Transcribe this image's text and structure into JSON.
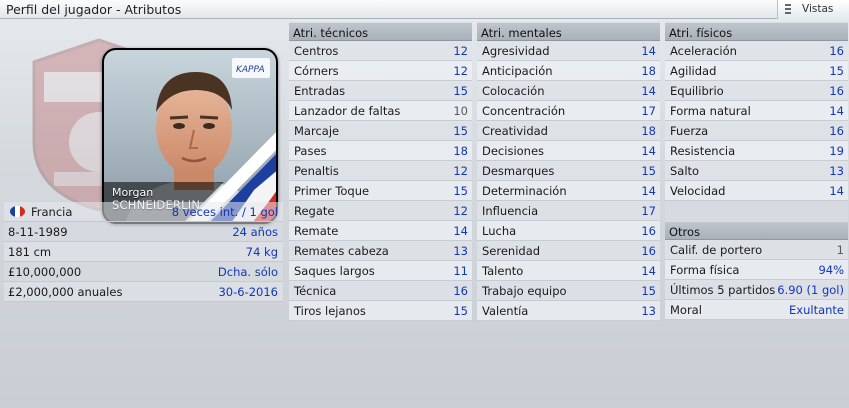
{
  "window": {
    "title": "Perfil del jugador - Atributos",
    "views_label": "Vistas"
  },
  "player": {
    "first_name": "Morgan",
    "last_name": "SCHNEIDERLIN",
    "info": [
      {
        "label": "Francia",
        "value": "8 veces int. / 1 gol",
        "flag": "fr"
      },
      {
        "label": "8-11-1989",
        "value": "24 años"
      },
      {
        "label": "181 cm",
        "value": "74 kg"
      },
      {
        "label": "£10,000,000",
        "value": "Dcha. sólo"
      },
      {
        "label": "£2,000,000 anuales",
        "value": "30-6-2016"
      }
    ]
  },
  "technical": {
    "title": "Atri. técnicos",
    "attrs": [
      {
        "name": "Centros",
        "value": "12"
      },
      {
        "name": "Córners",
        "value": "12"
      },
      {
        "name": "Entradas",
        "value": "15"
      },
      {
        "name": "Lanzador de faltas",
        "value": "10"
      },
      {
        "name": "Marcaje",
        "value": "15"
      },
      {
        "name": "Pases",
        "value": "18"
      },
      {
        "name": "Penaltis",
        "value": "12"
      },
      {
        "name": "Primer Toque",
        "value": "15"
      },
      {
        "name": "Regate",
        "value": "12"
      },
      {
        "name": "Remate",
        "value": "14"
      },
      {
        "name": "Remates cabeza",
        "value": "13"
      },
      {
        "name": "Saques largos",
        "value": "11"
      },
      {
        "name": "Técnica",
        "value": "16"
      },
      {
        "name": "Tiros lejanos",
        "value": "15"
      }
    ]
  },
  "mental": {
    "title": "Atri. mentales",
    "attrs": [
      {
        "name": "Agresividad",
        "value": "14"
      },
      {
        "name": "Anticipación",
        "value": "18"
      },
      {
        "name": "Colocación",
        "value": "14"
      },
      {
        "name": "Concentración",
        "value": "17"
      },
      {
        "name": "Creatividad",
        "value": "18"
      },
      {
        "name": "Decisiones",
        "value": "14"
      },
      {
        "name": "Desmarques",
        "value": "15"
      },
      {
        "name": "Determinación",
        "value": "14"
      },
      {
        "name": "Influencia",
        "value": "17"
      },
      {
        "name": "Lucha",
        "value": "16"
      },
      {
        "name": "Serenidad",
        "value": "16"
      },
      {
        "name": "Talento",
        "value": "14"
      },
      {
        "name": "Trabajo equipo",
        "value": "15"
      },
      {
        "name": "Valentía",
        "value": "13"
      }
    ]
  },
  "physical": {
    "title": "Atri. físicos",
    "attrs": [
      {
        "name": "Aceleración",
        "value": "16"
      },
      {
        "name": "Agilidad",
        "value": "15"
      },
      {
        "name": "Equilibrio",
        "value": "16"
      },
      {
        "name": "Forma natural",
        "value": "14"
      },
      {
        "name": "Fuerza",
        "value": "16"
      },
      {
        "name": "Resistencia",
        "value": "19"
      },
      {
        "name": "Salto",
        "value": "13"
      },
      {
        "name": "Velocidad",
        "value": "14"
      }
    ]
  },
  "other": {
    "title": "Otros",
    "attrs": [
      {
        "name": "Calif. de portero",
        "value": "1"
      },
      {
        "name": "Forma física",
        "value": "94%"
      },
      {
        "name": "Últimos 5 partidos",
        "value": "6.90 (1 gol)"
      },
      {
        "name": "Moral",
        "value": "Exultante"
      }
    ]
  },
  "colors": {
    "value_blue": "#1236b8",
    "flag_blue": "#1d3fa0",
    "flag_red": "#d62a24"
  }
}
